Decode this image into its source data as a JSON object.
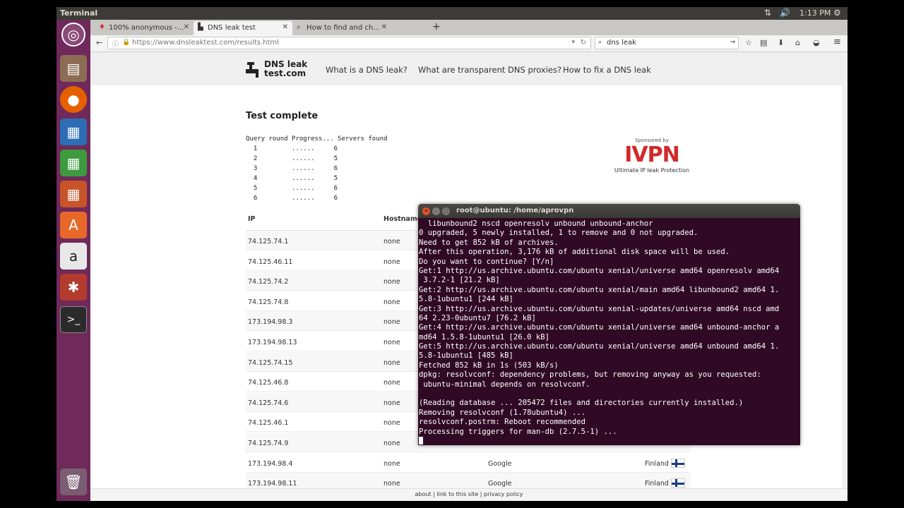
{
  "topbar": {
    "title": "Terminal",
    "clock": "1:13 PM"
  },
  "launcher": {
    "items": [
      "ubuntu-dash",
      "files",
      "firefox",
      "writer",
      "calc",
      "impress",
      "software-center",
      "amazon",
      "settings",
      "terminal",
      "trash"
    ]
  },
  "browser": {
    "tabs": [
      {
        "label": "100% anonymous -..."
      },
      {
        "label": "DNS leak test"
      },
      {
        "label": "How to find and ch..."
      }
    ],
    "url": "https://www.dnsleaktest.com/results.html",
    "search_value": "dns leak"
  },
  "site": {
    "logo_line1": "DNS leak",
    "logo_line2": "test.com",
    "nav": [
      "What is a DNS leak?",
      "What are transparent DNS proxies?",
      "How to fix a DNS leak"
    ],
    "test_title": "Test complete",
    "query_header": "Query round Progress... Servers found",
    "query_rows": [
      {
        "round": "1",
        "progress": "......",
        "servers": "6"
      },
      {
        "round": "2",
        "progress": "......",
        "servers": "5"
      },
      {
        "round": "3",
        "progress": "......",
        "servers": "6"
      },
      {
        "round": "4",
        "progress": "......",
        "servers": "5"
      },
      {
        "round": "5",
        "progress": "......",
        "servers": "6"
      },
      {
        "round": "6",
        "progress": "......",
        "servers": "6"
      }
    ],
    "sponsor_caption": "Sponsored by",
    "sponsor_logo": "IVPN",
    "sponsor_tagline": "Ultimate IP leak Protection",
    "table_headers": [
      "IP",
      "Hostname"
    ],
    "rows": [
      {
        "ip": "74.125.74.1",
        "hostname": "none",
        "isp": "",
        "country": ""
      },
      {
        "ip": "74.125.46.11",
        "hostname": "none",
        "isp": "",
        "country": ""
      },
      {
        "ip": "74.125.74.2",
        "hostname": "none",
        "isp": "",
        "country": ""
      },
      {
        "ip": "74.125.74.8",
        "hostname": "none",
        "isp": "",
        "country": ""
      },
      {
        "ip": "173.194.98.3",
        "hostname": "none",
        "isp": "",
        "country": ""
      },
      {
        "ip": "173.194.98.13",
        "hostname": "none",
        "isp": "",
        "country": ""
      },
      {
        "ip": "74.125.74.15",
        "hostname": "none",
        "isp": "",
        "country": ""
      },
      {
        "ip": "74.125.46.8",
        "hostname": "none",
        "isp": "",
        "country": ""
      },
      {
        "ip": "74.125.74.6",
        "hostname": "none",
        "isp": "",
        "country": ""
      },
      {
        "ip": "74.125.46.1",
        "hostname": "none",
        "isp": "",
        "country": ""
      },
      {
        "ip": "74.125.74.9",
        "hostname": "none",
        "isp": "",
        "country": ""
      },
      {
        "ip": "173.194.98.4",
        "hostname": "none",
        "isp": "Google",
        "country": "Finland"
      },
      {
        "ip": "173.194.98.11",
        "hostname": "none",
        "isp": "Google",
        "country": "Finland"
      }
    ],
    "footer": "about | link to this site | privacy policy"
  },
  "terminal": {
    "title": "root@ubuntu: /home/aprovpn",
    "lines": [
      "  libunbound2 nscd openresolv unbound unbound-anchor",
      "0 upgraded, 5 newly installed, 1 to remove and 0 not upgraded.",
      "Need to get 852 kB of archives.",
      "After this operation, 3,176 kB of additional disk space will be used.",
      "Do you want to continue? [Y/n]",
      "Get:1 http://us.archive.ubuntu.com/ubuntu xenial/universe amd64 openresolv amd64",
      " 3.7.2-1 [21.2 kB]",
      "Get:2 http://us.archive.ubuntu.com/ubuntu xenial/main amd64 libunbound2 amd64 1.",
      "5.8-1ubuntu1 [244 kB]",
      "Get:3 http://us.archive.ubuntu.com/ubuntu xenial-updates/universe amd64 nscd amd",
      "64 2.23-0ubuntu7 [76.2 kB]",
      "Get:4 http://us.archive.ubuntu.com/ubuntu xenial/universe amd64 unbound-anchor a",
      "md64 1.5.8-1ubuntu1 [26.0 kB]",
      "Get:5 http://us.archive.ubuntu.com/ubuntu xenial/universe amd64 unbound amd64 1.",
      "5.8-1ubuntu1 [485 kB]",
      "Fetched 852 kB in 1s (503 kB/s)",
      "dpkg: resolvconf: dependency problems, but removing anyway as you requested:",
      " ubuntu-minimal depends on resolvconf.",
      "",
      "(Reading database ... 205472 files and directories currently installed.)",
      "Removing resolvconf (1.78ubuntu4) ...",
      "resolvconf.postrm: Reboot recommended",
      "Processing triggers for man-db (2.7.5-1) ..."
    ]
  }
}
